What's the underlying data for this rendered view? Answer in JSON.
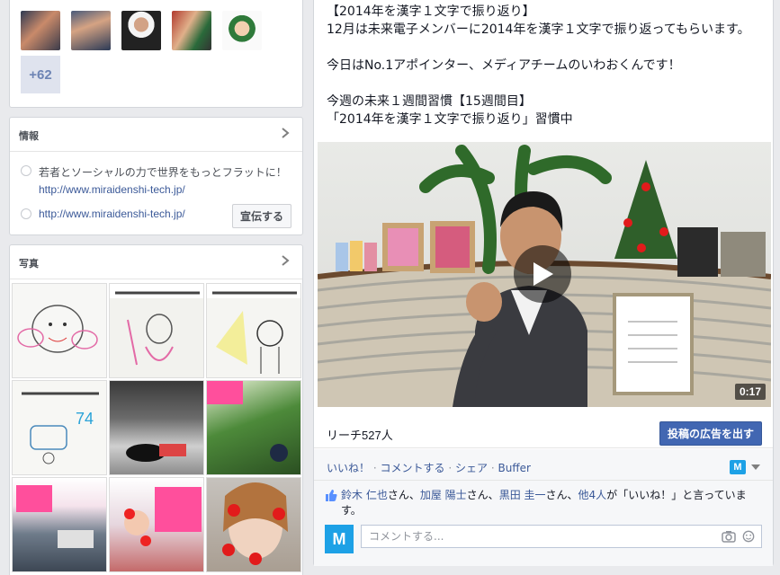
{
  "friends": {
    "more_count": "+62"
  },
  "info": {
    "title": "情報",
    "about": "若者とソーシャルの力で世界をもっとフラットに！",
    "about_link": "http://www.miraidenshi-tech.jp/",
    "website": "http://www.miraidenshi-tech.jp/",
    "promote_button": "宣伝する"
  },
  "photos": {
    "title": "写真"
  },
  "post": {
    "text": "【2014年を漢字１文字で振り返り】\n12月は未来電子メンバーに2014年を漢字１文字で振り返ってもらいます。\n\n今日はNo.1アポインター、メディアチームのいわおくんです！\n\n今週の未来１週間習慣【15週間目】\n「2014年を漢字１文字で振り返り」習慣中",
    "video_duration": "0:17",
    "reach": "リーチ527人",
    "boost_button": "投稿の広告を出す",
    "actions": {
      "like": "いいね！",
      "comment": "コメントする",
      "share": "シェア",
      "buffer": "Buffer"
    },
    "page_badge": "M",
    "likes": {
      "name1": "鈴木 仁也",
      "name2": "加屋 陽士",
      "name3": "黒田 圭一",
      "others": "他4人",
      "san": "さん、",
      "san_last": "さん、",
      "ga": "が",
      "suffix": "「いいね！」と言っています。"
    },
    "comment_placeholder": "コメントする..."
  },
  "colors": {
    "brand": "#3b5998",
    "button_blue": "#4267b2",
    "badge": "#1da1e6"
  }
}
